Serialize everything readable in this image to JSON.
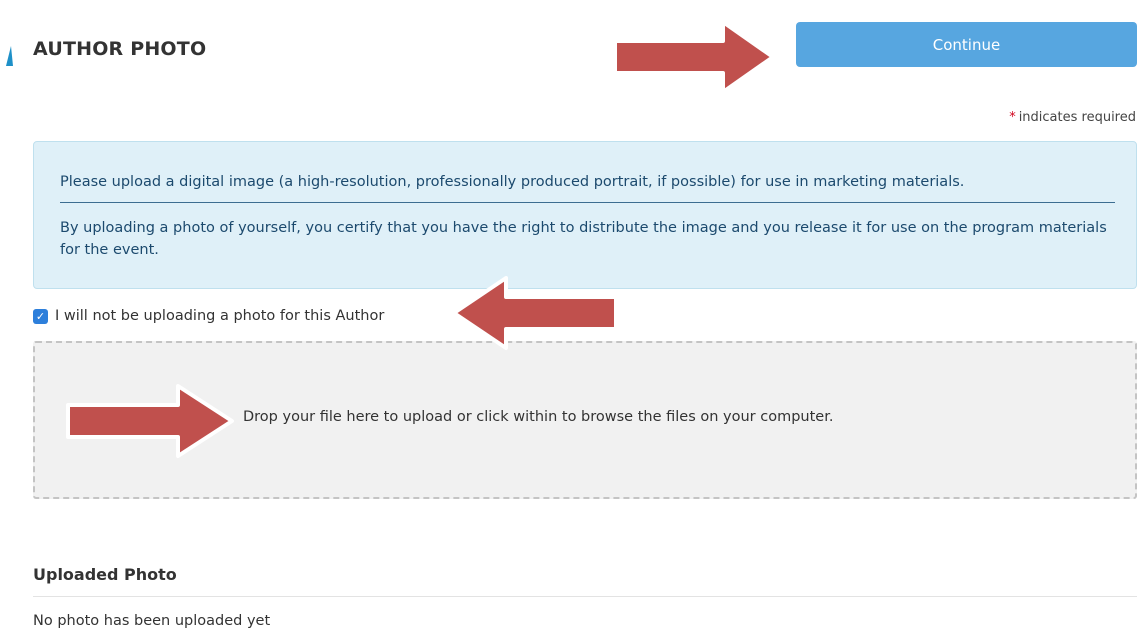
{
  "header": {
    "title": "AUTHOR PHOTO",
    "continue_label": "Continue"
  },
  "required_note": {
    "star": "*",
    "text": "indicates required"
  },
  "info": {
    "line1": "Please upload a digital image (a high-resolution, professionally produced portrait, if possible) for use in marketing materials.",
    "line2": "By uploading a photo of yourself, you certify that you have the right to distribute the image and you release it for use on the program materials for the event."
  },
  "no_photo_checkbox": {
    "checked": true,
    "label": "I will not be uploading a photo for this Author"
  },
  "dropzone": {
    "text": "Drop your file here to upload or click within to browse the files on your computer."
  },
  "uploaded": {
    "title": "Uploaded Photo",
    "empty_text": "No photo has been uploaded yet"
  },
  "colors": {
    "accent": "#57a6e0",
    "annotation_arrow": "#c0504d",
    "info_bg": "#dff0f8",
    "required_star": "#d0021b"
  },
  "icons": {
    "checkbox": "checkmark-icon",
    "annotation": "arrow-icon"
  }
}
